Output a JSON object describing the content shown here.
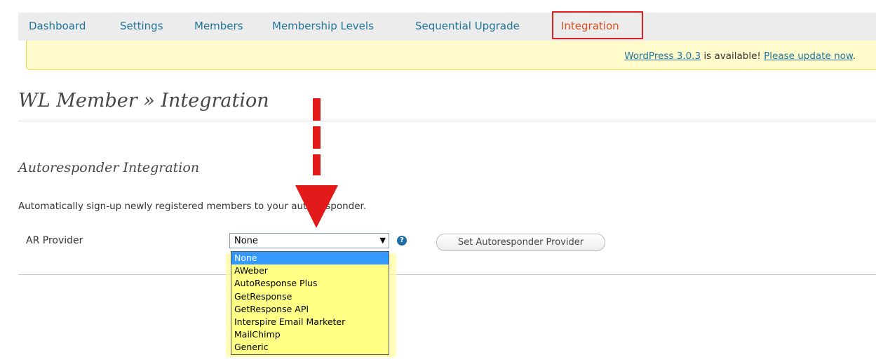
{
  "nav": {
    "items": [
      {
        "label": "Dashboard"
      },
      {
        "label": "Settings"
      },
      {
        "label": "Members"
      },
      {
        "label": "Membership Levels"
      },
      {
        "label": "Sequential Upgrade"
      },
      {
        "label": "Integration",
        "active": true
      }
    ]
  },
  "notice": {
    "link1": "WordPress 3.0.3",
    "middle": " is available! ",
    "link2": "Please update now",
    "end": "."
  },
  "page": {
    "title": "WL Member » Integration",
    "section_title": "Autoresponder Integration",
    "description": "Automatically sign-up newly registered members to your auto-responder."
  },
  "form": {
    "label": "AR Provider",
    "selected": "None",
    "help_glyph": "?",
    "button": "Set Autoresponder Provider",
    "options": [
      "None",
      "AWeber",
      "AutoResponse Plus",
      "GetResponse",
      "GetResponse API",
      "Interspire Email Marketer",
      "MailChimp",
      "Generic"
    ]
  },
  "colors": {
    "link": "#21759b",
    "active_tab": "#d54e21",
    "highlight_box": "#e02020",
    "notice_bg": "#fffbcc",
    "dropdown_bg": "#ffff86",
    "selected_option": "#3399ff",
    "arrow": "#e21a1a"
  }
}
